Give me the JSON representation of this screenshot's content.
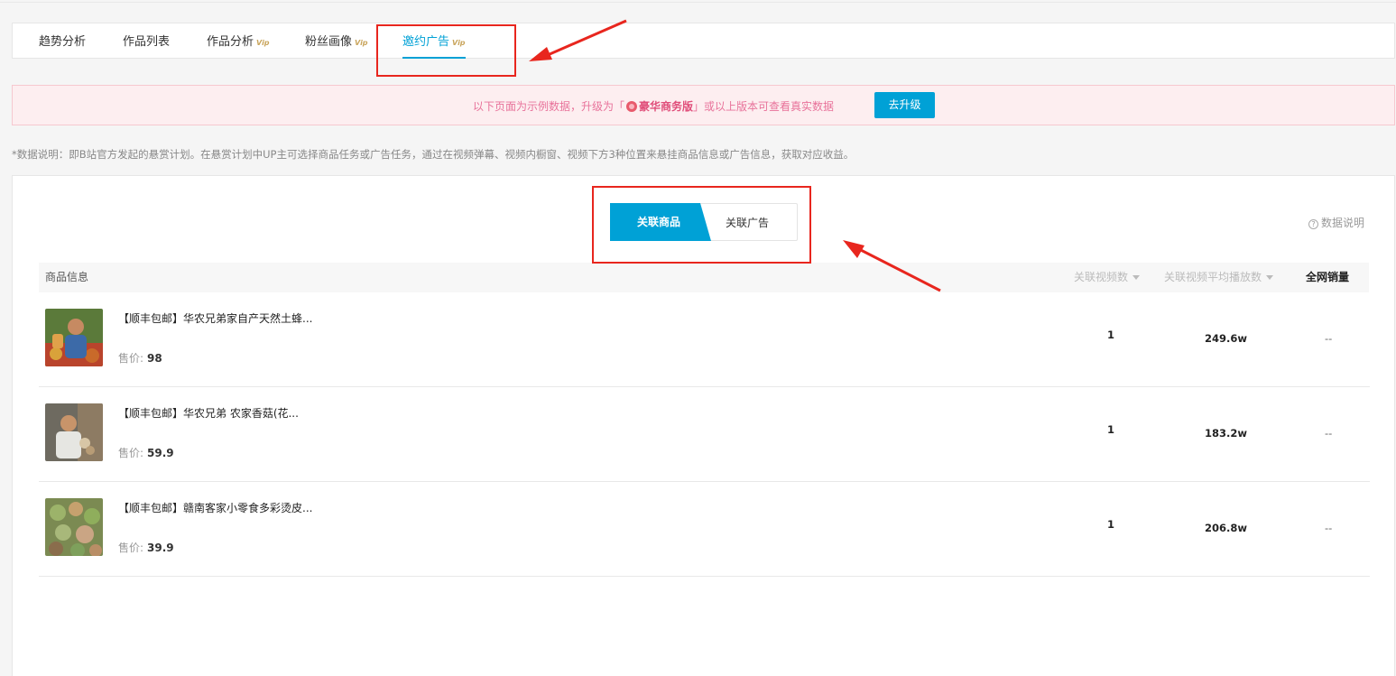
{
  "tabs": [
    {
      "label": "趋势分析",
      "vip": ""
    },
    {
      "label": "作品列表",
      "vip": ""
    },
    {
      "label": "作品分析",
      "vip": "Vip"
    },
    {
      "label": "粉丝画像",
      "vip": "Vip"
    },
    {
      "label": "邀约广告",
      "vip": "Vip"
    }
  ],
  "banner": {
    "text_before": "以下页面为示例数据，升级为「",
    "plan": "豪华商务版",
    "text_after": "」或以上版本可查看真实数据",
    "button": "去升级"
  },
  "note": "*数据说明：即B站官方发起的悬赏计划。在悬赏计划中UP主可选择商品任务或广告任务，通过在视频弹幕、视频内橱窗、视频下方3种位置来悬挂商品信息或广告信息，获取对应收益。",
  "toggle": {
    "active": "关联商品",
    "other": "关联广告"
  },
  "help": {
    "icon": "?",
    "label": "数据说明"
  },
  "table": {
    "headers": {
      "product": "商品信息",
      "videos": "关联视频数",
      "avg_plays": "关联视频平均播放数",
      "sales": "全网销量"
    },
    "price_label": "售价:",
    "rows": [
      {
        "title": "【顺丰包邮】华农兄弟家自产天然土蜂...",
        "price": "98",
        "videos": "1",
        "avg_plays": "249.6w",
        "sales": "--"
      },
      {
        "title": "【顺丰包邮】华农兄弟 农家香菇(花...",
        "price": "59.9",
        "videos": "1",
        "avg_plays": "183.2w",
        "sales": "--"
      },
      {
        "title": "【顺丰包邮】赣南客家小零食多彩烫皮...",
        "price": "39.9",
        "videos": "1",
        "avg_plays": "206.8w",
        "sales": "--"
      }
    ]
  },
  "colors": {
    "accent": "#00a1d6",
    "banner_bg": "#fdeef0",
    "annotation": "#e8261e"
  }
}
